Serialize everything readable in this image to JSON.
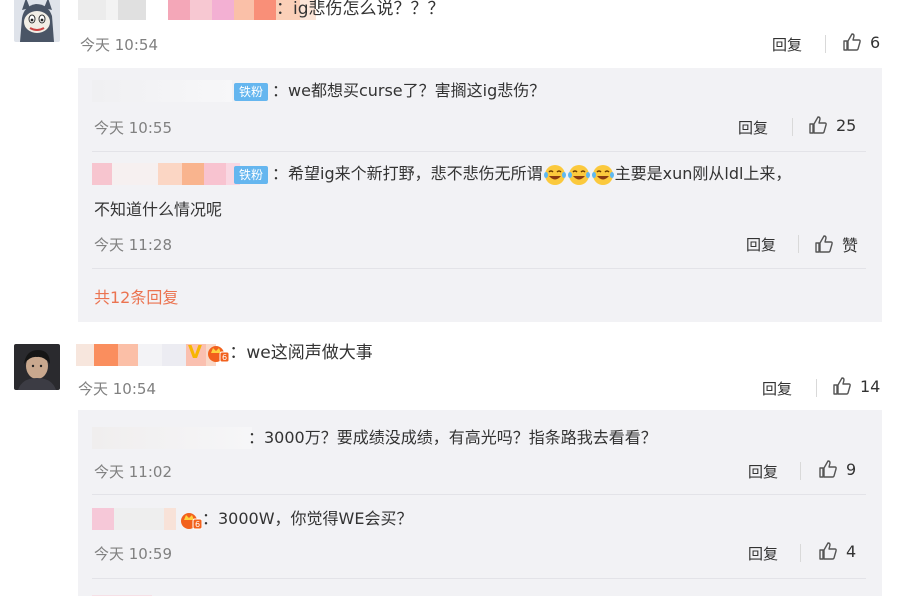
{
  "comments": [
    {
      "text": "：ig悲伤怎么说？？？",
      "time": "今天 10:54",
      "reply_label": "回复",
      "likes": "6",
      "replies": [
        {
          "badge": "铁粉",
          "text": "：we都想买curse了？害搁这ig悲伤？",
          "time": "今天 10:55",
          "reply_label": "回复",
          "likes": "25"
        },
        {
          "badge": "铁粉",
          "text_part1": "：希望ig来个新打野，悲不悲伤无所谓",
          "text_part2": "主要是xun刚从ldl上来，",
          "text_line2": "不知道什么情况呢",
          "time": "今天 11:28",
          "reply_label": "回复",
          "likes": "赞"
        }
      ],
      "more_replies": "共12条回复"
    },
    {
      "text": "：we这阅声做大事",
      "time": "今天 10:54",
      "reply_label": "回复",
      "likes": "14",
      "replies": [
        {
          "text": "：3000万？要成绩没成绩，有高光吗？指条路我去看看？",
          "time": "今天 11:02",
          "reply_label": "回复",
          "likes": "9"
        },
        {
          "text": "：3000W，你觉得WE会买？",
          "time": "今天 10:59",
          "reply_label": "回复",
          "likes": "4"
        }
      ]
    }
  ],
  "icons": {
    "thumb": "thumbs-up-icon",
    "emoji": "laughing-tears-emoji",
    "verified": "verified-v-icon",
    "vip": "vip-crown-icon"
  },
  "colors": {
    "badge": "#65b6ef",
    "link": "#eb7350",
    "reply_bg": "#f2f2f5",
    "time": "#808080"
  }
}
